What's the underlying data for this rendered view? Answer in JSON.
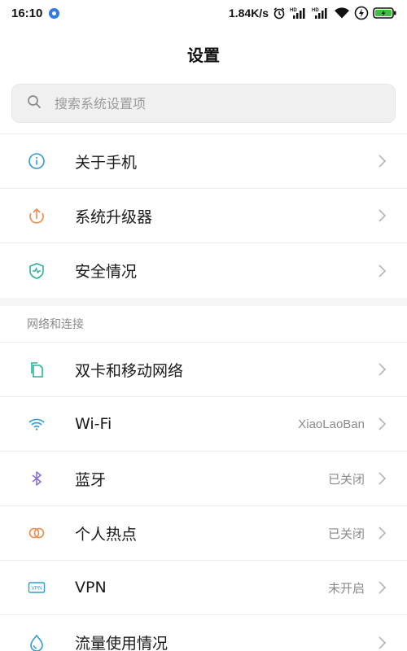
{
  "status_bar": {
    "time": "16:10",
    "net_speed": "1.84K/s",
    "icons": [
      "alarm-icon",
      "signal-hd-1-icon",
      "signal-hd-2-icon",
      "wifi-icon",
      "charging-icon",
      "battery-icon"
    ]
  },
  "header": {
    "title": "设置"
  },
  "search": {
    "placeholder": "搜索系统设置项"
  },
  "group1": {
    "items": [
      {
        "label": "关于手机",
        "icon": "info-icon",
        "color": "#2f9bd6"
      },
      {
        "label": "系统升级器",
        "icon": "upgrade-icon",
        "color": "#f08a4b"
      },
      {
        "label": "安全情况",
        "icon": "shield-icon",
        "color": "#2bb39a"
      }
    ]
  },
  "network_section": {
    "header": "网络和连接",
    "items": [
      {
        "label": "双卡和移动网络",
        "value": "",
        "icon": "sim-card-icon",
        "color": "#2bb39a"
      },
      {
        "label": "Wi-Fi",
        "value": "XiaoLaoBan",
        "icon": "wifi-icon",
        "color": "#2f9bd6"
      },
      {
        "label": "蓝牙",
        "value": "已关闭",
        "icon": "bluetooth-icon",
        "color": "#8a6fd8"
      },
      {
        "label": "个人热点",
        "value": "已关闭",
        "icon": "hotspot-icon",
        "color": "#f08a4b"
      },
      {
        "label": "VPN",
        "value": "未开启",
        "icon": "vpn-icon",
        "color": "#2f9bd6"
      },
      {
        "label": "流量使用情况",
        "value": "",
        "icon": "data-usage-icon",
        "color": "#2f9bd6"
      }
    ]
  }
}
